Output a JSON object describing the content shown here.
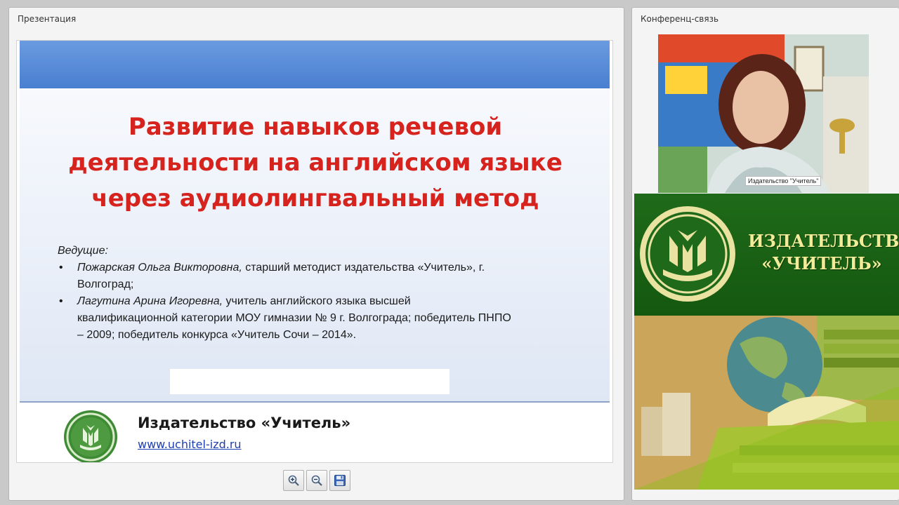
{
  "presentation": {
    "panel_title": "Презентация",
    "slide": {
      "title_lines": [
        "Развитие навыков речевой",
        "деятельности на английском языке",
        "через аудиолингвальный метод"
      ],
      "leaders_heading": "Ведущие:",
      "leaders": [
        {
          "name": "Пожарская Ольга Викторовна,",
          "desc_line1": " старший методист издательства «Учитель», г.",
          "desc_line2": "Волгоград;"
        },
        {
          "name": "Лагутина Арина Игоревна,",
          "desc_line1": " учитель английского языка высшей",
          "desc_line2": "квалификационной категории МОУ гимназии № 9 г. Волгограда; победитель ПНПО",
          "desc_line3": "– 2009; победитель конкурса «Учитель Сочи – 2014»."
        }
      ],
      "publisher_name": "Издательство «Учитель»",
      "publisher_url": "www.uchitel-izd.ru"
    },
    "toolbar": {
      "zoom_in_icon": "zoom-in-icon",
      "zoom_out_icon": "zoom-out-icon",
      "save_icon": "floppy-disk-icon"
    }
  },
  "conference": {
    "panel_title": "Конференц-связь",
    "video_label": "Издательство \"Учитель\"",
    "banner_line1": "ИЗДАТЕЛЬСТВО",
    "banner_line2": "«УЧИТЕЛЬ»"
  },
  "colors": {
    "title_red": "#d6231d",
    "slide_blue": "#4a7fd0",
    "banner_green": "#1f6a1a",
    "banner_text": "#f2ec9a"
  }
}
